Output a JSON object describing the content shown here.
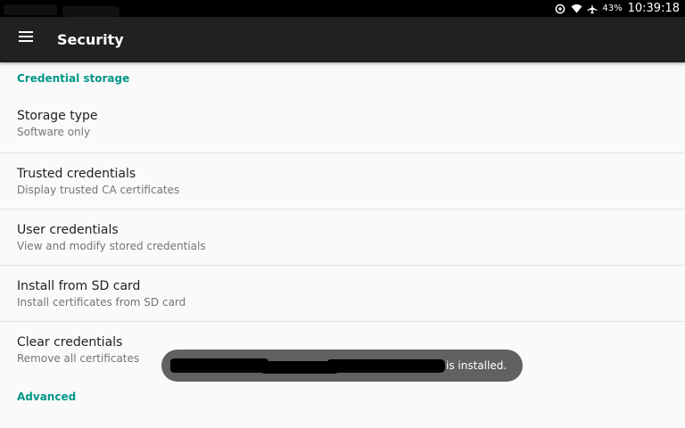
{
  "status_bar": {
    "battery_percent": "43%",
    "time": "10:39:18",
    "icons": [
      "data-saver-icon",
      "wifi-icon",
      "airplane-icon"
    ]
  },
  "app_bar": {
    "title": "Security",
    "menu_icon": "hamburger-menu-icon"
  },
  "sections": [
    {
      "header": "Credential storage",
      "items": [
        {
          "title": "Storage type",
          "summary": "Software only"
        },
        {
          "title": "Trusted credentials",
          "summary": "Display trusted CA certificates"
        },
        {
          "title": "User credentials",
          "summary": "View and modify stored credentials"
        },
        {
          "title": "Install from SD card",
          "summary": "Install certificates from SD card"
        },
        {
          "title": "Clear credentials",
          "summary": "Remove all certificates"
        }
      ]
    },
    {
      "header": "Advanced",
      "items": []
    }
  ],
  "toast": {
    "text": "is installed."
  },
  "colors": {
    "accent": "#009688",
    "app_bar": "#212121",
    "status_bar": "#000000",
    "background": "#fafafa",
    "toast": "#616161"
  }
}
